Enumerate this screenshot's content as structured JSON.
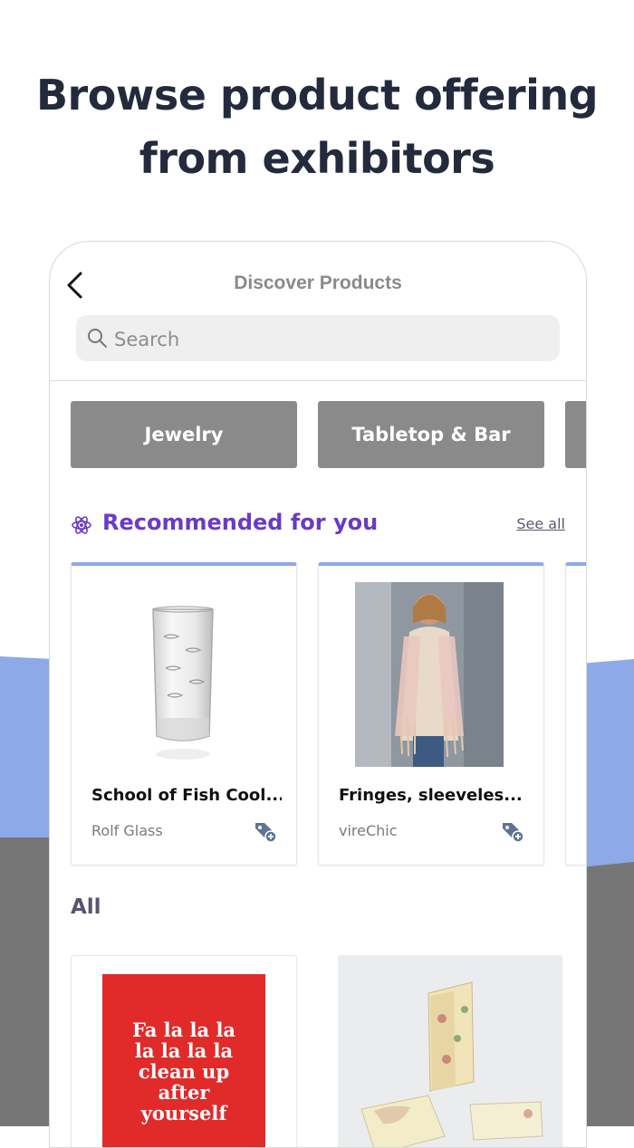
{
  "headline": {
    "line1": "Browse product offering",
    "line2": "from exhibitors"
  },
  "screen": {
    "title": "Discover Products"
  },
  "search": {
    "placeholder": "Search"
  },
  "categories": [
    "Jewelry",
    "Tabletop & Bar"
  ],
  "recommended": {
    "title": "Recommended for you",
    "see_all": "See all",
    "items": [
      {
        "name": "School of Fish Cool...",
        "vendor": "Rolf Glass"
      },
      {
        "name": "Fringes, sleeveles...",
        "vendor": "vireChic"
      }
    ]
  },
  "all": {
    "title": "All",
    "items": [
      {
        "image_text": [
          "Fa la la la",
          "la la la la",
          "clean up",
          "after",
          "yourself"
        ]
      },
      {
        "image_text": []
      }
    ]
  },
  "colors": {
    "headline": "#232a3b",
    "accent_purple": "#6a3bc4",
    "card_top_border": "#8ea9e8",
    "chip_bg": "#8a8a8a",
    "bg_blue": "#8ea9e8",
    "bg_gray": "#767676"
  }
}
